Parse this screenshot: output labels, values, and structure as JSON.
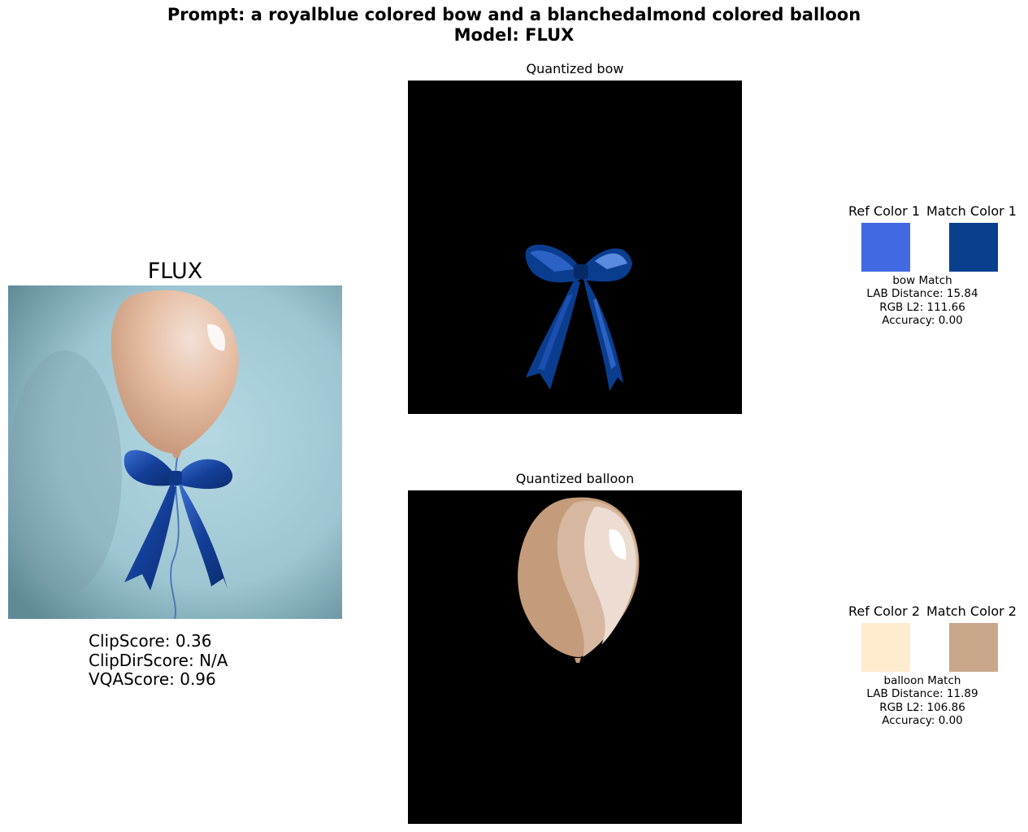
{
  "header": {
    "prompt_line": "Prompt: a royalblue colored bow and a blanchedalmond colored balloon",
    "model_line": "Model: FLUX"
  },
  "generated": {
    "title": "FLUX",
    "scores": {
      "clip": "ClipScore: 0.36",
      "clipdir": "ClipDirScore: N/A",
      "vqa": "VQAScore: 0.96"
    }
  },
  "quantized": [
    {
      "title": "Quantized bow"
    },
    {
      "title": "Quantized balloon"
    }
  ],
  "matches": [
    {
      "ref_label": "Ref Color 1",
      "match_label": "Match Color 1",
      "ref_color": "#4169E1",
      "match_color": "#0A3F8E",
      "name": "bow Match",
      "lab": "LAB Distance: 15.84",
      "rgb": "RGB L2: 111.66",
      "accuracy": "Accuracy: 0.00"
    },
    {
      "ref_label": "Ref Color 2",
      "match_label": "Match Color 2",
      "ref_color": "#FFEBCD",
      "match_color": "#C9A78B",
      "name": "balloon Match",
      "lab": "LAB Distance: 11.89",
      "rgb": "RGB L2: 106.86",
      "accuracy": "Accuracy: 0.00"
    }
  ]
}
